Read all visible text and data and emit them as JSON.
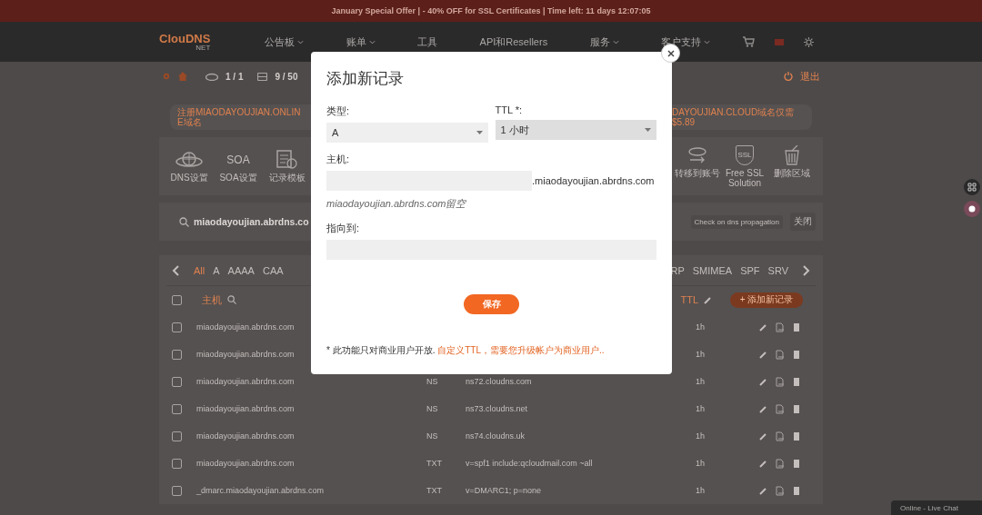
{
  "promo_bar": {
    "text": "January Special Offer | - 40% OFF for SSL Certificates | Time left: 11 days 12:07:05"
  },
  "nav": {
    "logo": "ClouDNS",
    "logo_sub": "NET",
    "items": [
      {
        "label": "公告板",
        "dropdown": true
      },
      {
        "label": "账单",
        "dropdown": true
      },
      {
        "label": "工具",
        "dropdown": false
      },
      {
        "label": "API和Resellers",
        "dropdown": false
      },
      {
        "label": "服务",
        "dropdown": true
      },
      {
        "label": "客户支持",
        "dropdown": true
      }
    ]
  },
  "subbar": {
    "zones": "1 / 1",
    "records": "9 / 50",
    "logout": "退出"
  },
  "banner": {
    "left": "注册MIAODAYOUJIAN.ONLINE域名",
    "right": "DAYOUJIAN.CLOUD域名仅需$5.89"
  },
  "tools": {
    "left": [
      {
        "kind": "globe",
        "label": "DNS设置"
      },
      {
        "kind": "text",
        "glyph": "SOA",
        "label": "SOA设置"
      },
      {
        "kind": "document",
        "label": "记录模板"
      }
    ],
    "right": [
      {
        "kind": "transfer",
        "label": "转移到账号"
      },
      {
        "kind": "shield",
        "glyph": "SSL",
        "label": "Free SSL Solution"
      },
      {
        "kind": "trash",
        "label": "删除区域"
      }
    ]
  },
  "search": {
    "zone": "miaodayoujian.abrdns.co",
    "buttons": [
      "Check on dns propagation",
      "关闭"
    ]
  },
  "record_tabs": {
    "left": [
      {
        "label": "All",
        "selected": true
      },
      {
        "label": "A",
        "selected": false
      },
      {
        "label": "AAAA",
        "selected": false
      },
      {
        "label": "CAA",
        "selected": false
      }
    ],
    "right": [
      {
        "label": "RP",
        "selected": false
      },
      {
        "label": "SMIMEA",
        "selected": false
      },
      {
        "label": "SPF",
        "selected": false
      },
      {
        "label": "SRV",
        "selected": false
      }
    ]
  },
  "table": {
    "header_checked": false,
    "host_header": "主机",
    "ttl_header": "TTL",
    "add_button": "+ 添加新记录",
    "rows": [
      {
        "checked": false,
        "host": "miaodayoujian.abrdns.com",
        "ttl": "1h"
      },
      {
        "checked": false,
        "host": "miaodayoujian.abrdns.com",
        "ttl": "1h"
      },
      {
        "checked": false,
        "host": "miaodayoujian.abrdns.com",
        "type": "NS",
        "value": "ns72.cloudns.com",
        "ttl": "1h"
      },
      {
        "checked": false,
        "host": "miaodayoujian.abrdns.com",
        "type": "NS",
        "value": "ns73.cloudns.net",
        "ttl": "1h"
      },
      {
        "checked": false,
        "host": "miaodayoujian.abrdns.com",
        "type": "NS",
        "value": "ns74.cloudns.uk",
        "ttl": "1h"
      },
      {
        "checked": false,
        "host": "miaodayoujian.abrdns.com",
        "type": "TXT",
        "value": "v=spf1 include:qcloudmail.com ~all",
        "ttl": "1h"
      },
      {
        "checked": false,
        "host": "_dmarc.miaodayoujian.abrdns.com",
        "type": "TXT",
        "value": "v=DMARC1; p=none",
        "ttl": "1h"
      }
    ]
  },
  "live_chat": {
    "text": "Online - Live Chat"
  },
  "modal": {
    "title": "添加新记录",
    "type_label": "类型:",
    "type_value": "A",
    "ttl_label": "TTL *:",
    "ttl_value": "1 小时",
    "ttl_disabled": true,
    "host_label": "主机:",
    "host_suffix": ".miaodayoujian.abrdns.com",
    "host_hint": "miaodayoujian.abrdns.com留空",
    "target_label": "指向到:",
    "save": "保存",
    "note": "* 此功能只对商业用户开放. ",
    "note_link": "自定义TTL，需要您升级帐户为商业用户.."
  }
}
